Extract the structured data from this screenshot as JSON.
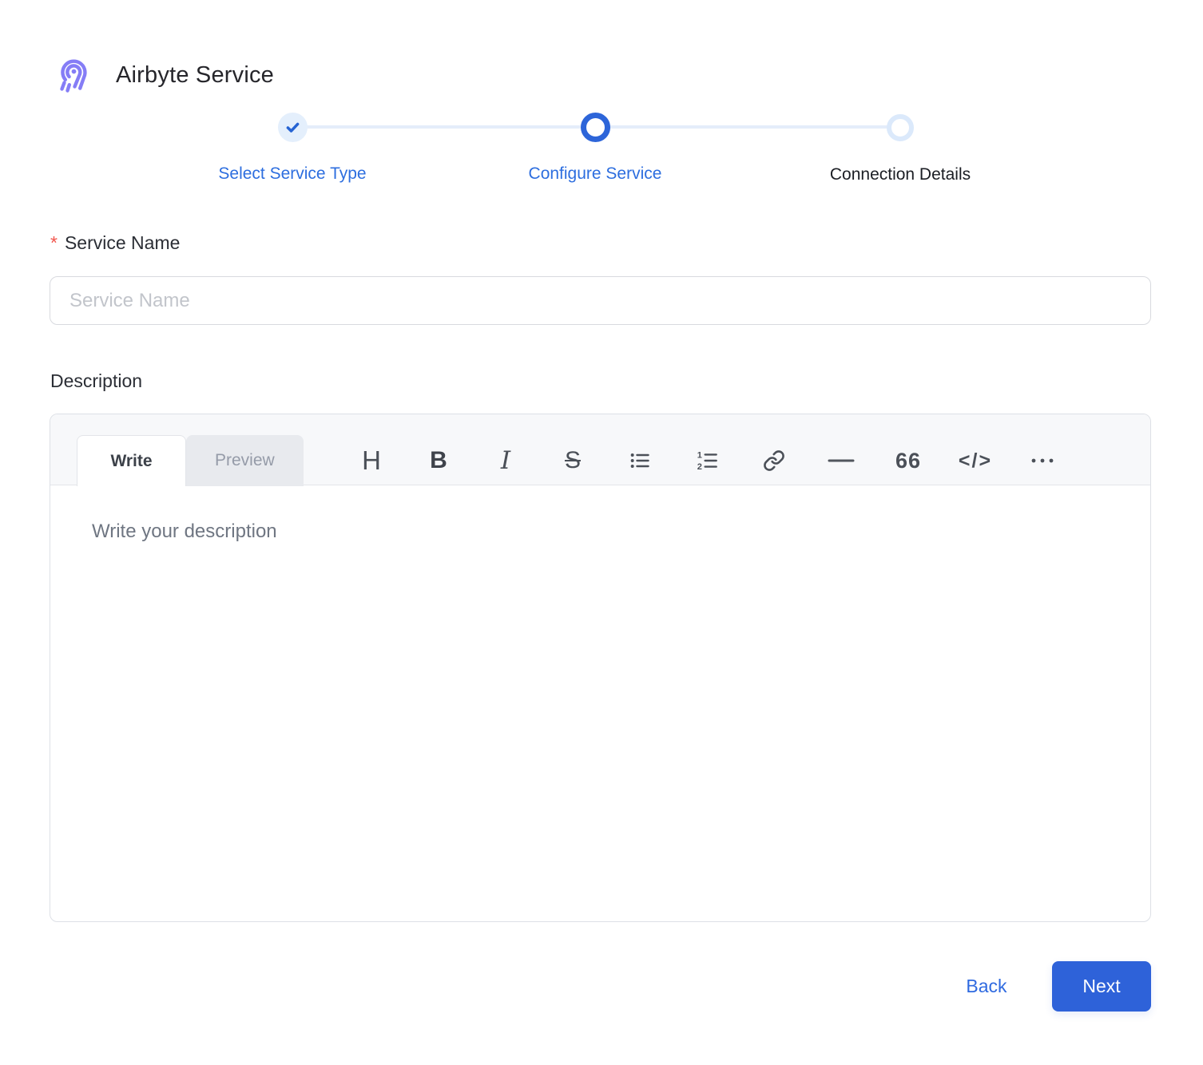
{
  "app": {
    "title": "Airbyte Service"
  },
  "stepper": {
    "steps": [
      {
        "label": "Select Service Type",
        "state": "completed"
      },
      {
        "label": "Configure Service",
        "state": "active"
      },
      {
        "label": "Connection Details",
        "state": "upcoming"
      }
    ]
  },
  "form": {
    "service_name": {
      "label": "Service Name",
      "required_marker": "*",
      "value": "",
      "placeholder": "Service Name"
    },
    "description": {
      "label": "Description",
      "tabs": [
        {
          "label": "Write",
          "active": true
        },
        {
          "label": "Preview",
          "active": false
        }
      ],
      "toolbar": [
        {
          "name": "heading-icon",
          "glyph": "H"
        },
        {
          "name": "bold-icon",
          "glyph": "B"
        },
        {
          "name": "italic-icon",
          "glyph": "I"
        },
        {
          "name": "strikethrough-icon",
          "glyph": "S"
        },
        {
          "name": "unordered-list-icon",
          "glyph": null
        },
        {
          "name": "ordered-list-icon",
          "glyph": null
        },
        {
          "name": "link-icon",
          "glyph": null
        },
        {
          "name": "horizontal-rule-icon",
          "glyph": null
        },
        {
          "name": "quote-icon",
          "glyph": "66"
        },
        {
          "name": "code-icon",
          "glyph": "</>"
        },
        {
          "name": "more-icon",
          "glyph": null
        }
      ],
      "value": "",
      "placeholder": "Write your description"
    }
  },
  "footer": {
    "back_label": "Back",
    "next_label": "Next"
  },
  "colors": {
    "accent_blue": "#2e62d9",
    "step_label_blue": "#2d6edf",
    "completed_circle_bg": "#e4effc",
    "upcoming_ring": "#dbe9fb",
    "stepper_line": "#e4edfa",
    "logo_purple": "#857df6",
    "required_red": "#f2564d"
  }
}
